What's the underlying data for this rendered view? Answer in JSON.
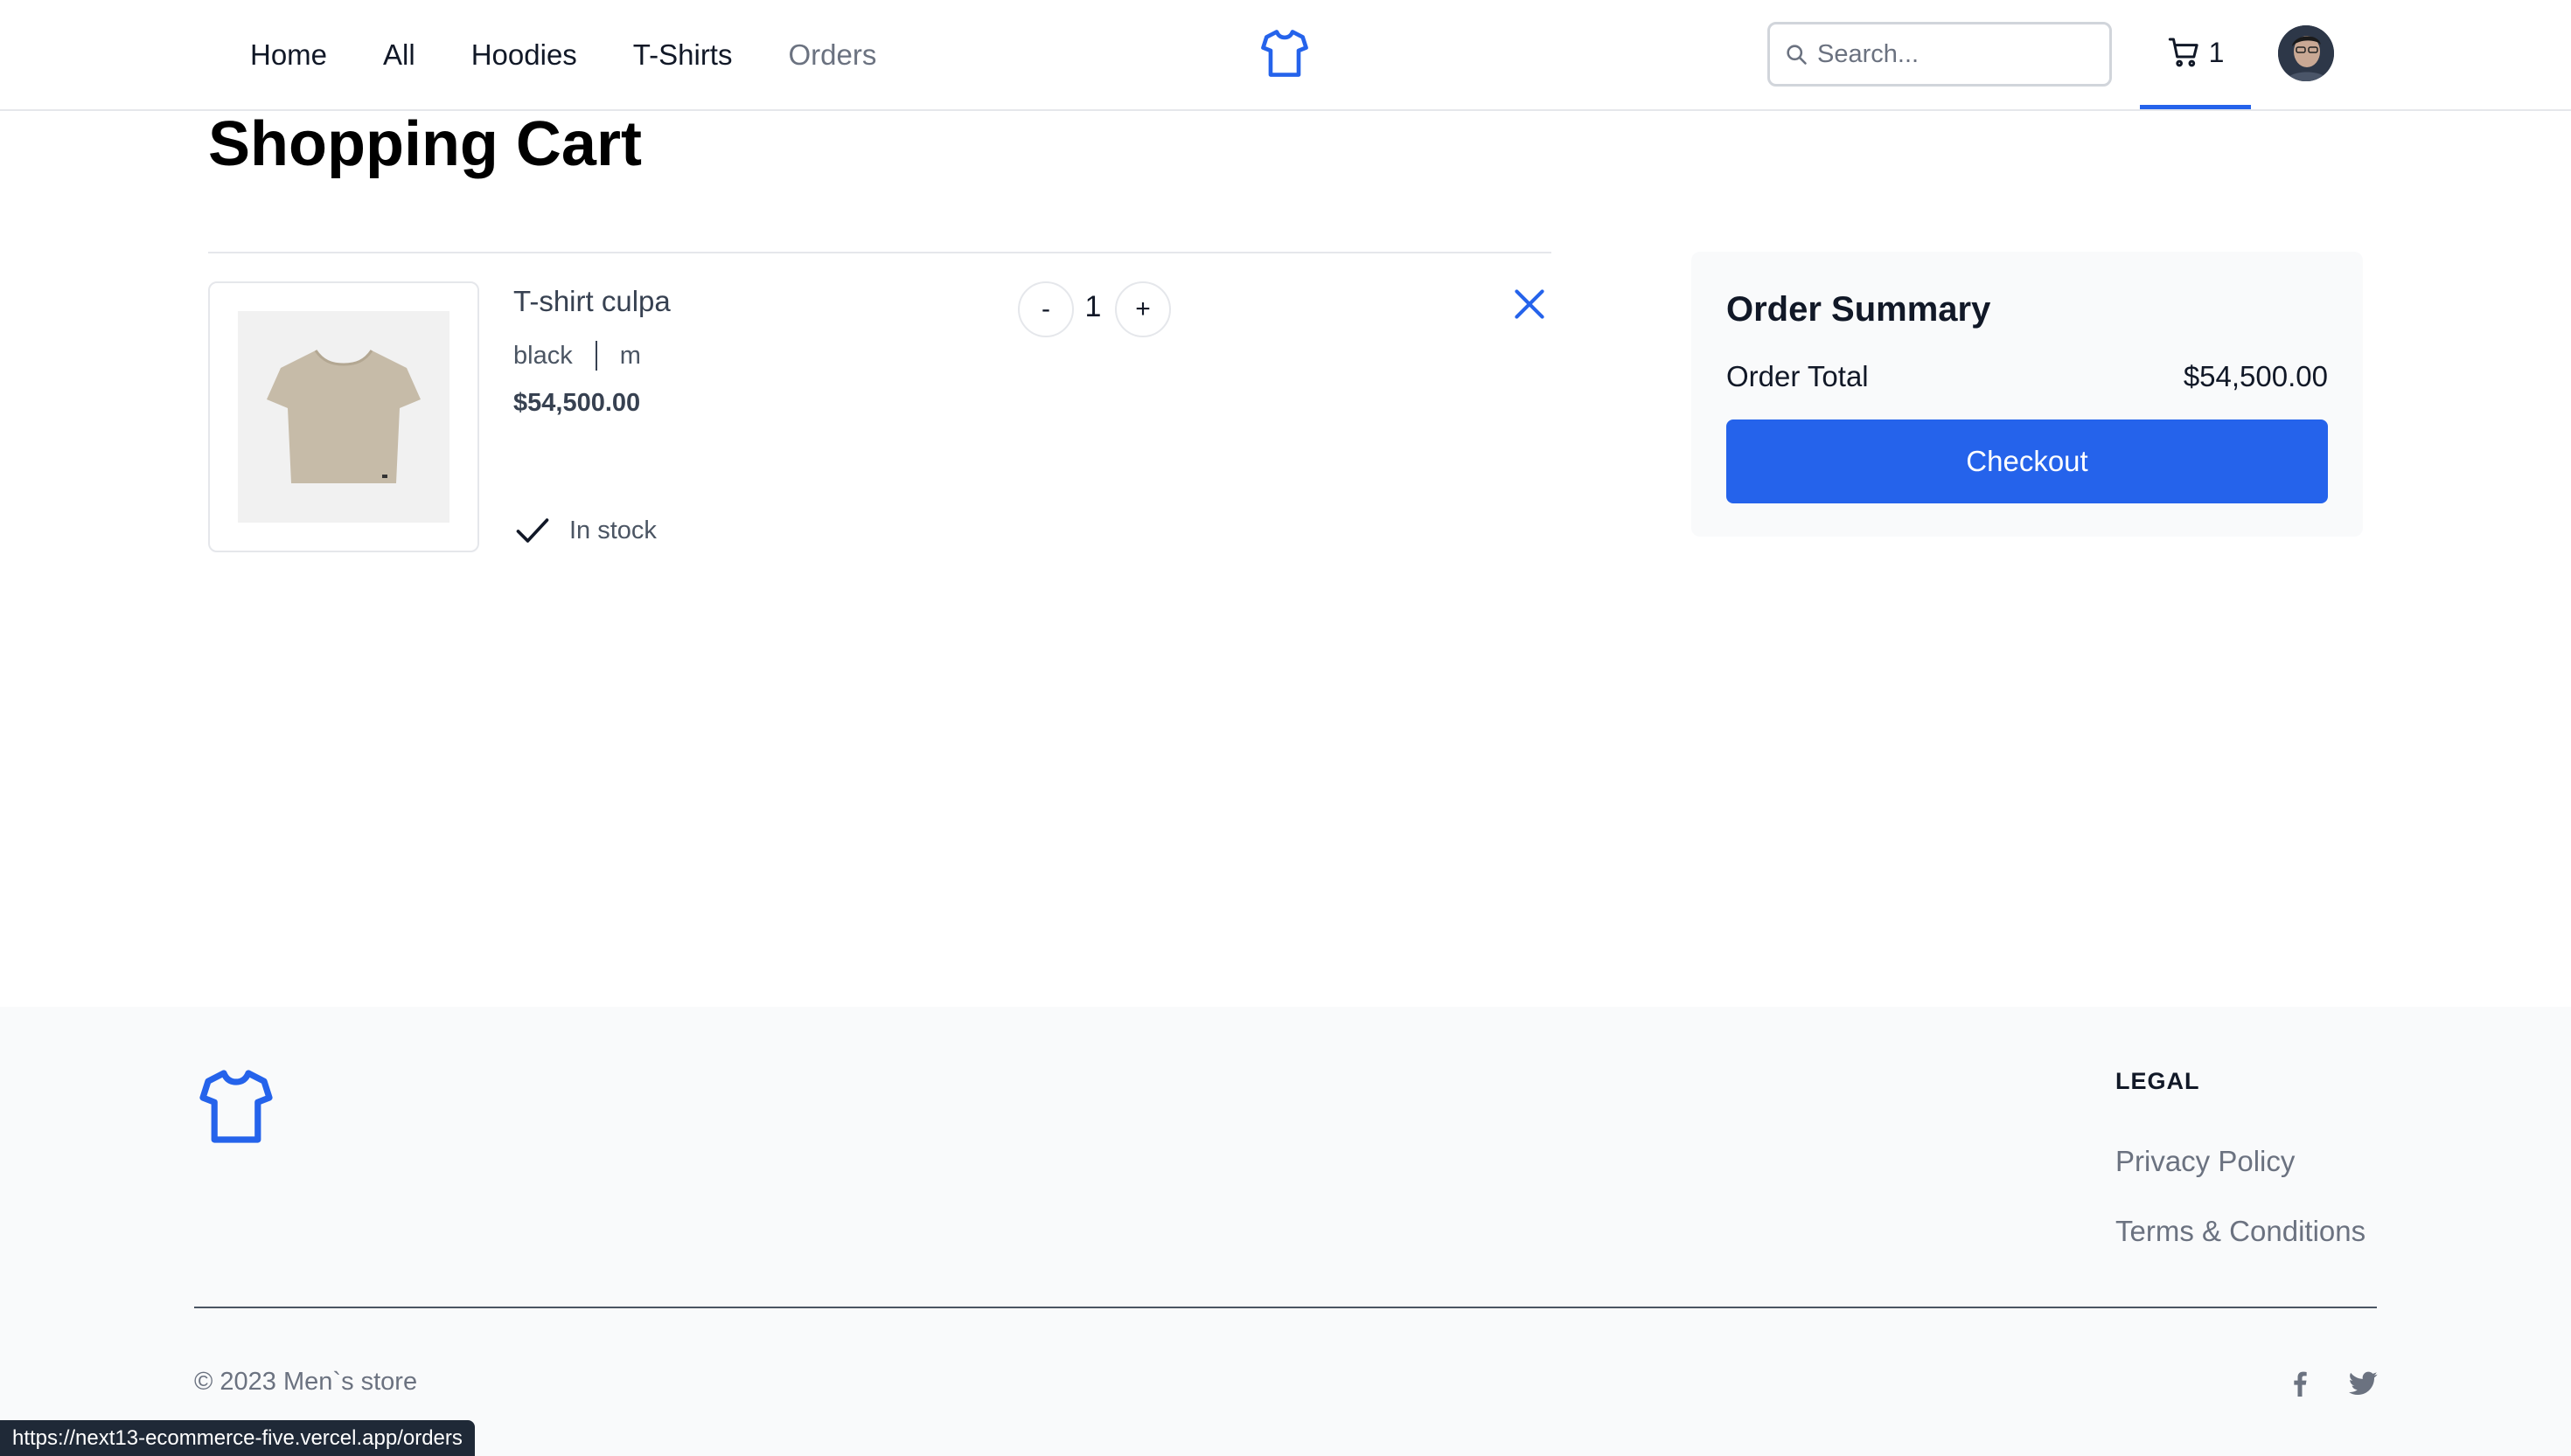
{
  "header": {
    "nav": [
      {
        "label": "Home"
      },
      {
        "label": "All"
      },
      {
        "label": "Hoodies"
      },
      {
        "label": "T-Shirts"
      },
      {
        "label": "Orders"
      }
    ],
    "logo_icon": "tshirt-icon",
    "search": {
      "placeholder": "Search...",
      "value": ""
    },
    "cart_count": "1",
    "accent_color": "#2563eb"
  },
  "page": {
    "title": "Shopping Cart"
  },
  "cart": {
    "items": [
      {
        "name": "T-shirt culpa",
        "color": "black",
        "size": "m",
        "price": "$54,500.00",
        "quantity": "1",
        "stock_status": "In stock",
        "decrement_label": "-",
        "increment_label": "+"
      }
    ]
  },
  "summary": {
    "title": "Order Summary",
    "total_label": "Order Total",
    "total_value": "$54,500.00",
    "checkout_label": "Checkout"
  },
  "footer": {
    "legal_title": "LEGAL",
    "links": [
      {
        "label": "Privacy Policy"
      },
      {
        "label": "Terms & Conditions"
      }
    ],
    "copyright": "© 2023 Men`s store",
    "social_icons": [
      "facebook-icon",
      "twitter-icon"
    ]
  },
  "status_bar": {
    "url": "https://next13-ecommerce-five.vercel.app/orders"
  }
}
